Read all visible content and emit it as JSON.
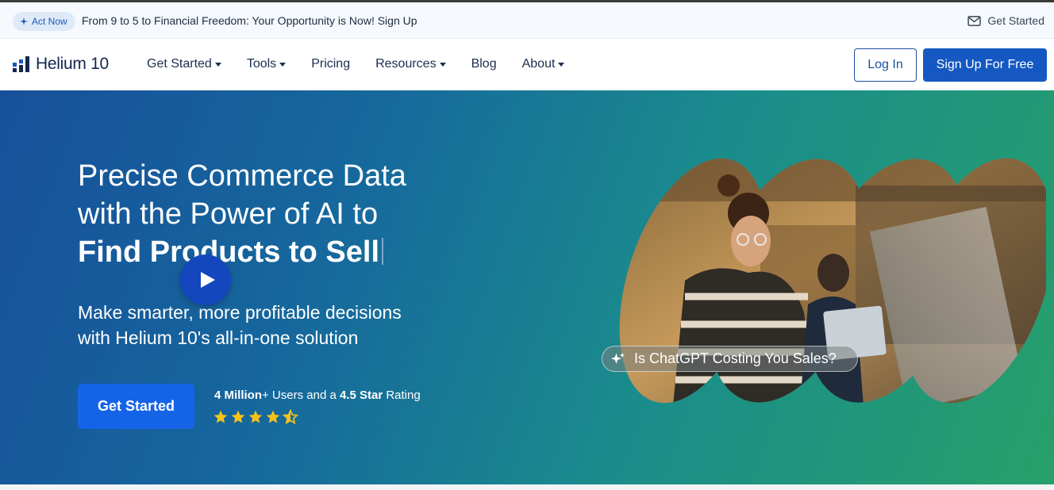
{
  "announcement": {
    "pill_label": "Act Now",
    "message": "From 9 to 5 to Financial Freedom: Your Opportunity is Now! Sign Up",
    "right_link": "Get Started"
  },
  "nav": {
    "brand": "Helium 10",
    "items": [
      {
        "label": "Get Started",
        "dropdown": true
      },
      {
        "label": "Tools",
        "dropdown": true
      },
      {
        "label": "Pricing",
        "dropdown": false
      },
      {
        "label": "Resources",
        "dropdown": true
      },
      {
        "label": "Blog",
        "dropdown": false
      },
      {
        "label": "About",
        "dropdown": true
      }
    ],
    "login_label": "Log In",
    "signup_label": "Sign Up For Free"
  },
  "hero": {
    "headline_line1": "Precise Commerce Data",
    "headline_line2": "with the Power of AI to",
    "headline_bold": "Find Products to Sell",
    "sub_line1": "Make smarter, more profitable decisions",
    "sub_line2": "with Helium 10's all-in-one solution",
    "cta_label": "Get Started",
    "rating_users_bold": "4 Million",
    "rating_users_rest": "+ Users and a ",
    "rating_star_bold": "4.5 Star",
    "rating_tail": " Rating",
    "star_rating": 4.5,
    "video_caption": "Is ChatGPT Costing You Sales?"
  },
  "colors": {
    "brand_blue": "#1558c2",
    "hero_gradient_start": "#17509a",
    "hero_gradient_end": "#27a06a",
    "star_yellow": "#f6c21a",
    "play_button": "#1447bd"
  },
  "icons": {
    "pill_icon": "sparkle-icon",
    "right_link_icon": "envelope-icon",
    "logo_icon": "bar-chart-icon",
    "play_icon": "play-icon",
    "caption_icon": "sparkle-icon"
  }
}
